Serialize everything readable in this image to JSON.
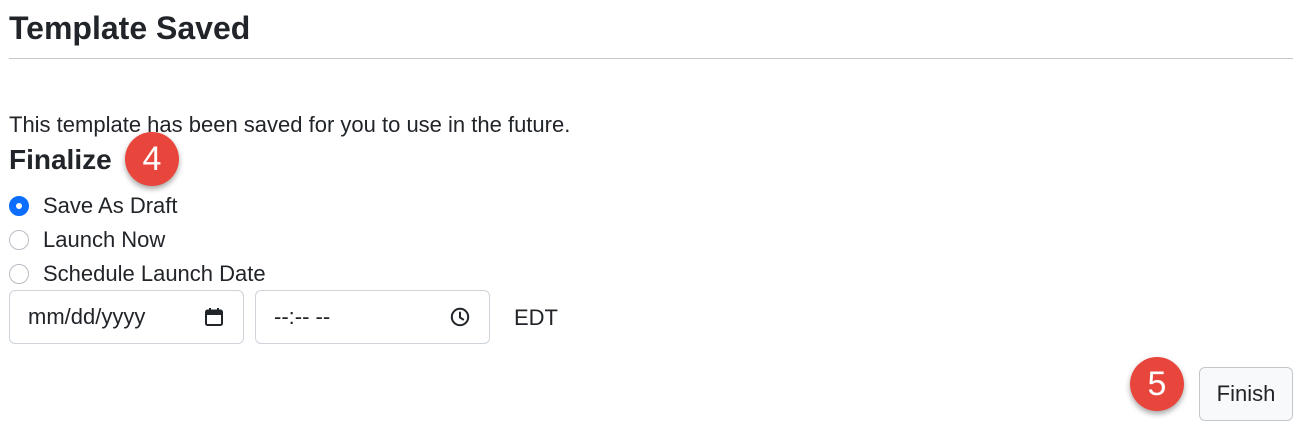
{
  "header": {
    "title": "Template Saved"
  },
  "message": "This template has been saved for you to use in the future.",
  "finalize": {
    "heading": "Finalize",
    "options": [
      {
        "label": "Save As Draft",
        "checked": true
      },
      {
        "label": "Launch Now",
        "checked": false
      },
      {
        "label": "Schedule Launch Date",
        "checked": false
      }
    ],
    "date_placeholder": "mm/dd/yyyy",
    "time_placeholder": "--:-- --",
    "timezone": "EDT"
  },
  "annotations": {
    "step_4": "4",
    "step_5": "5"
  },
  "actions": {
    "finish_label": "Finish"
  },
  "colors": {
    "accent": "#0d6efd",
    "badge": "#e8453c"
  }
}
